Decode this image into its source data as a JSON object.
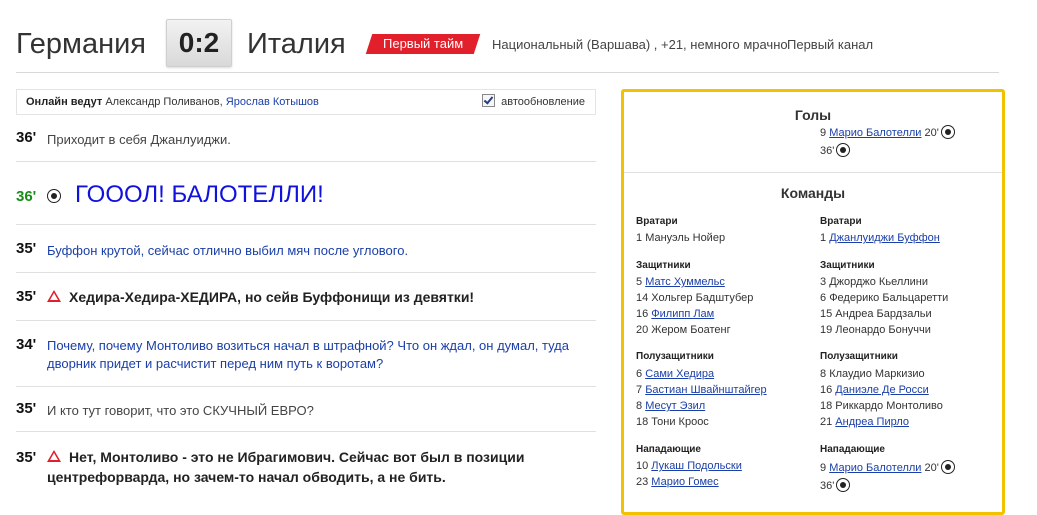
{
  "header": {
    "home_team": "Германия",
    "score": "0:2",
    "away_team": "Италия",
    "period": "Первый тайм",
    "venue": "Национальный (Варшава) , +21, немного мрачно",
    "channel": "Первый канал"
  },
  "feed": {
    "hosts_label": "Онлайн ведут",
    "host1": "Александр Поливанов, ",
    "host2": "Ярослав Котышов",
    "autoupdate_label": "автообновление",
    "entries": [
      {
        "minute": "36'",
        "text": "Приходит в себя Джанлуиджи."
      },
      {
        "minute": "36'",
        "text": "ГОООЛ! БАЛОТЕЛЛИ!"
      },
      {
        "minute": "35'",
        "text": "Буффон крутой, сейчас отлично выбил мяч после углового."
      },
      {
        "minute": "35'",
        "text": "Хедира-Хедира-ХЕДИРА, но сейв Буффонищи из девятки!"
      },
      {
        "minute": "34'",
        "text_line1": "Почему, почему Монтоливо возиться начал в штрафной? Что он ждал, он думал, туда",
        "text_line2": "дворник придет и расчистит перед ним путь к воротам?"
      },
      {
        "minute": "35'",
        "text": "И кто тут говорит, что это СКУЧНЫЙ ЕВРО?"
      },
      {
        "minute": "35'",
        "text_line1": "Нет, Монтоливо - это не Ибрагимович. Сейчас вот был в позиции",
        "text_line2": "центрефорварда, но зачем-то начал обводить, а не бить."
      }
    ]
  },
  "panel": {
    "goals_title": "Голы",
    "goal_line1_num": "9 ",
    "goal_line1_name": "Марио Балотелли",
    "goal_line1_min": " 20'",
    "goal_line2_min": "36'",
    "teams_title": "Команды",
    "home": {
      "gk_label": "Вратари",
      "gk": [
        {
          "num": "1",
          "name": "Мануэль Нойер",
          "link": false
        }
      ],
      "df_label": "Защитники",
      "df": [
        {
          "num": "5 ",
          "name": "Матс Хуммельс",
          "link": true
        },
        {
          "num": "14 ",
          "name": "Хольгер Бадштубер",
          "link": false
        },
        {
          "num": "16 ",
          "name": "Филипп Лам",
          "link": true
        },
        {
          "num": "20 ",
          "name": "Жером Боатенг",
          "link": false
        }
      ],
      "mf_label": "Полузащитники",
      "mf": [
        {
          "num": "6 ",
          "name": "Сами Хедира",
          "link": true
        },
        {
          "num": "7 ",
          "name": "Бастиан Швайнштайгер",
          "link": true
        },
        {
          "num": "8 ",
          "name": "Месут Эзил",
          "link": true
        },
        {
          "num": "18 ",
          "name": "Тони Кроос",
          "link": false
        }
      ],
      "fw_label": "Нападающие",
      "fw": [
        {
          "num": "10 ",
          "name": "Лукаш Подольски",
          "link": true
        },
        {
          "num": "23 ",
          "name": "Марио Гомес",
          "link": true
        }
      ]
    },
    "away": {
      "gk_label": "Вратари",
      "gk": [
        {
          "num": "1 ",
          "name": "Джанлуиджи Буффон",
          "link": true
        }
      ],
      "df_label": "Защитники",
      "df": [
        {
          "num": "3 ",
          "name": "Джорджо Кьеллини",
          "link": false
        },
        {
          "num": "6 ",
          "name": "Федерико Бальцаретти",
          "link": false
        },
        {
          "num": "15 ",
          "name": "Андреа Бардзальи",
          "link": false
        },
        {
          "num": "19 ",
          "name": "Леонардо Бонуччи",
          "link": false
        }
      ],
      "mf_label": "Полузащитники",
      "mf": [
        {
          "num": "8 ",
          "name": "Клаудио Маркизио",
          "link": false
        },
        {
          "num": "16 ",
          "name": "Даниэле Де Росси",
          "link": true
        },
        {
          "num": "18 ",
          "name": "Риккардо Монтоливо",
          "link": false
        },
        {
          "num": "21 ",
          "name": "Андреа Пирло",
          "link": true
        }
      ],
      "fw_label": "Нападающие",
      "fw": [
        {
          "num": "9 ",
          "name": "Марио Балотелли",
          "link": true,
          "suffix": " 20'"
        },
        {
          "num": "",
          "name": "36'",
          "link": false
        }
      ]
    }
  },
  "colors": {
    "accent_red": "#e1202b",
    "panel_border": "#f2c200",
    "link_blue": "#1a3fa8",
    "goal_blue": "#1111dd",
    "goal_minute_green": "#1a8c1a"
  }
}
